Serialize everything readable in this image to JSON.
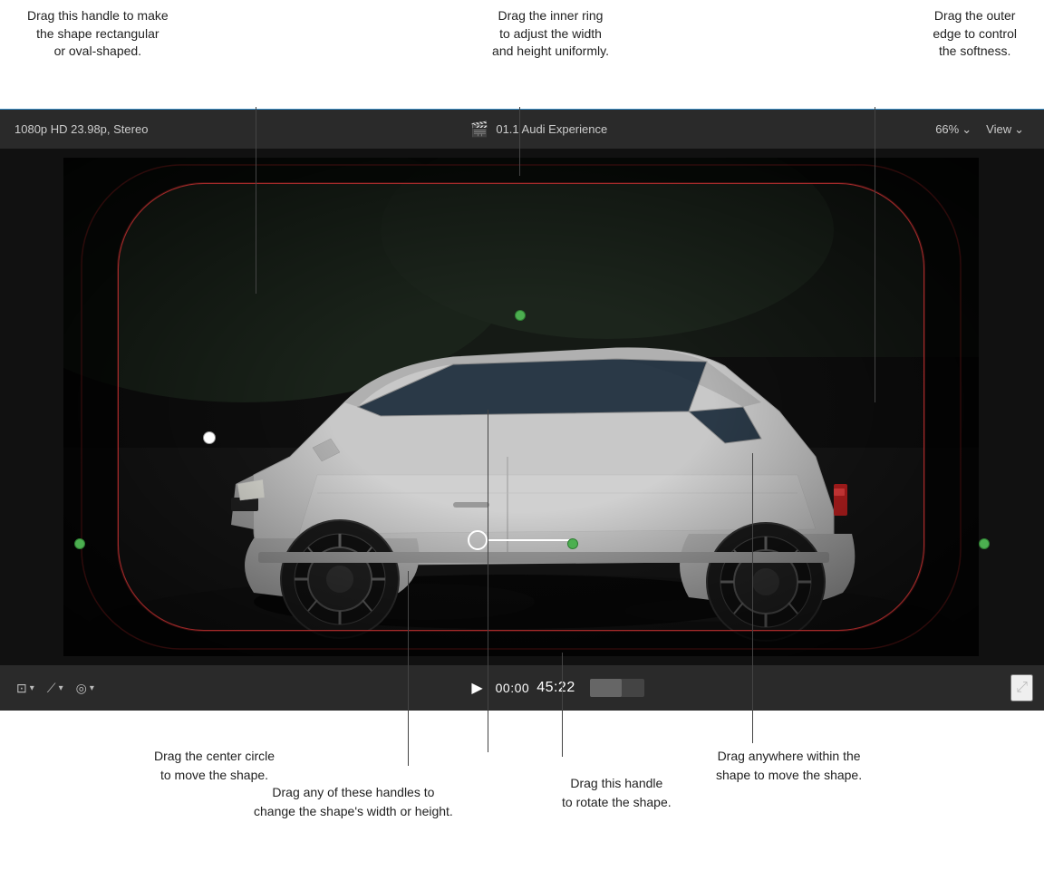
{
  "annotations": {
    "top_left": {
      "text": "Drag this handle to make\nthe shape rectangular\nor oval-shaped.",
      "lines": [
        "Drag this handle to make",
        "the shape rectangular",
        "or oval-shaped."
      ]
    },
    "top_center": {
      "text": "Drag the inner ring\nto adjust the width\nand height uniformly.",
      "lines": [
        "Drag the inner ring",
        "to adjust the width",
        "and height uniformly."
      ]
    },
    "top_right": {
      "text": "Drag the outer\nedge to control\nthe softness.",
      "lines": [
        "Drag the outer",
        "edge to control",
        "the softness."
      ]
    },
    "bottom_left": {
      "text": "Drag the center circle\nto move the shape.",
      "lines": [
        "Drag the center circle",
        "to move the shape."
      ]
    },
    "bottom_center_left": {
      "text": "Drag any of these handles to\nchange the shape's width or height.",
      "lines": [
        "Drag any of these handles to",
        "change the shape's width or height."
      ]
    },
    "bottom_center_right": {
      "text": "Drag this handle\nto rotate the shape.",
      "lines": [
        "Drag this handle",
        "to rotate the shape."
      ]
    },
    "bottom_right": {
      "text": "Drag anywhere within the\nshape to move the shape.",
      "lines": [
        "Drag anywhere within the",
        "shape to move the shape."
      ]
    }
  },
  "player": {
    "format": "1080p HD 23.98p, Stereo",
    "title": "01.1 Audi Experience",
    "zoom": "66%",
    "view_label": "View",
    "timecode_prefix": "00:00",
    "timecode_main": "45:22",
    "clapper_icon": "🎬"
  },
  "controls": {
    "crop_label": "crop",
    "transform_label": "transform",
    "speed_label": "speed",
    "play_icon": "▶",
    "fullscreen_icon": "⤢"
  }
}
